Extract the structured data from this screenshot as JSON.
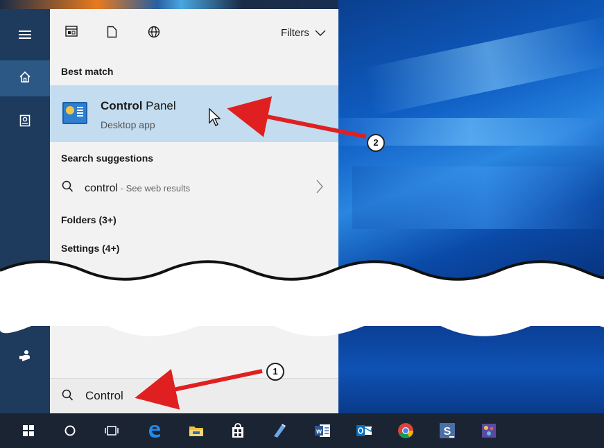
{
  "toolbar": {
    "icons": [
      "document-grid-icon",
      "file-icon",
      "globe-icon"
    ],
    "filters_label": "Filters"
  },
  "sections": {
    "best_match": "Best match",
    "search_suggestions": "Search suggestions",
    "folders": "Folders (3+)",
    "settings": "Settings (4+)"
  },
  "best_match_item": {
    "title_bold": "Control",
    "title_rest": " Panel",
    "subtitle": "Desktop app",
    "icon": "control-panel-icon"
  },
  "suggestion": {
    "query": "control",
    "hint": " - See web results"
  },
  "search": {
    "value": "Control"
  },
  "annotations": {
    "step1": "1",
    "step2": "2"
  },
  "colors": {
    "accent": "#c3dcef",
    "arrow": "#e02020",
    "sidebar": "#1e3a5c",
    "taskbar": "#1b2433"
  },
  "sidebar_icons": [
    "hamburger-icon",
    "home-icon",
    "notebook-icon",
    "feedback-icon"
  ],
  "taskbar_icons": [
    "windows-icon",
    "cortana-icon",
    "task-view-icon",
    "edge-icon",
    "file-explorer-icon",
    "store-icon",
    "pen-app-icon",
    "word-icon",
    "outlook-icon",
    "chrome-icon",
    "snagit-icon",
    "paint-app-icon"
  ]
}
